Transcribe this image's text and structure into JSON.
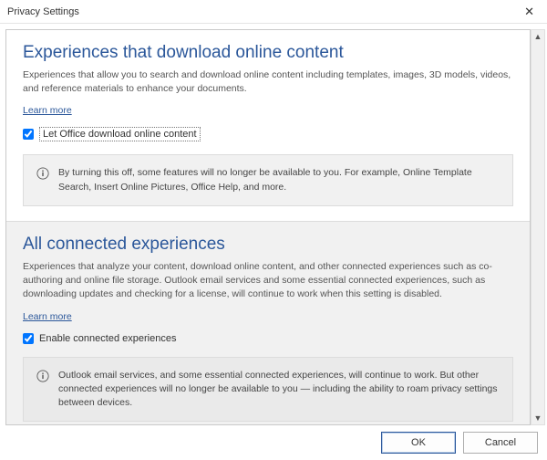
{
  "window": {
    "title": "Privacy Settings"
  },
  "sections": {
    "download": {
      "title": "Experiences that download online content",
      "desc": "Experiences that allow you to search and download online content including templates, images, 3D models, videos, and reference materials to enhance your documents.",
      "learn_more": "Learn more",
      "checkbox_label": "Let Office download online content",
      "info": "By turning this off, some features will no longer be available to you. For example, Online Template Search, Insert Online Pictures, Office Help, and more."
    },
    "connected": {
      "title": "All connected experiences",
      "desc": "Experiences that analyze your content, download online content, and other connected experiences such as co-authoring and online file storage. Outlook email services and some essential connected experiences, such as downloading updates and checking for a license, will continue to work when this setting is disabled.",
      "learn_more": "Learn more",
      "checkbox_label": "Enable connected experiences",
      "info": "Outlook email services, and some essential connected experiences, will continue to work. But other connected experiences will no longer be available to you — including the ability to roam privacy settings between devices."
    }
  },
  "buttons": {
    "ok": "OK",
    "cancel": "Cancel"
  }
}
